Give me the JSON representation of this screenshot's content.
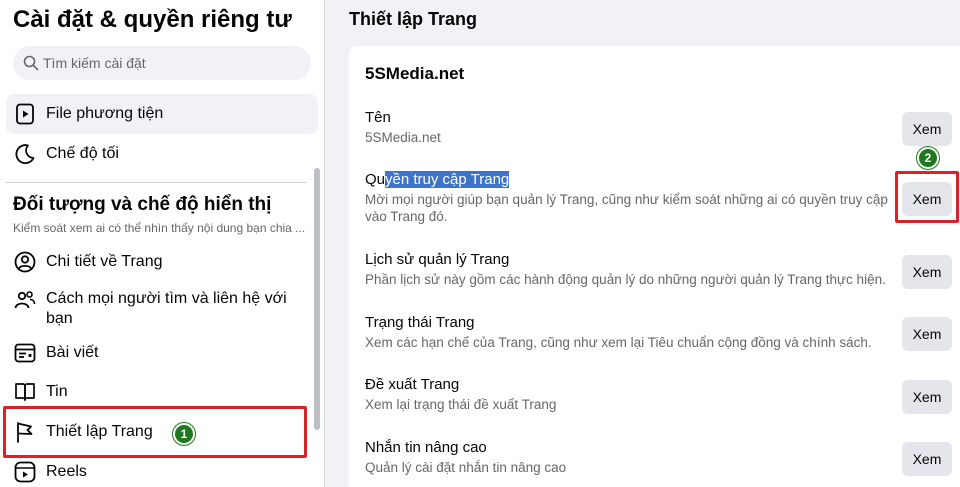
{
  "sidebar": {
    "title": "Cài đặt & quyền riêng tư",
    "search_placeholder": "Tìm kiếm cài đặt",
    "items_top": [
      {
        "label": "File phương tiện",
        "icon": "media-file-icon"
      },
      {
        "label": "Chế độ tối",
        "icon": "moon-icon"
      }
    ],
    "section_title": "Đối tượng và chế độ hiển thị",
    "section_subtitle": "Kiểm soát xem ai có thể nhìn thấy nội dung bạn chia ...",
    "items": [
      {
        "label": "Chi tiết về Trang",
        "icon": "person-icon"
      },
      {
        "label": "Cách mọi người tìm và liên hệ với bạn",
        "icon": "people-icon"
      },
      {
        "label": "Bài viết",
        "icon": "post-icon"
      },
      {
        "label": "Tin",
        "icon": "book-icon"
      },
      {
        "label": "Thiết lập Trang",
        "icon": "flag-icon"
      },
      {
        "label": "Reels",
        "icon": "reels-icon"
      }
    ]
  },
  "annotations": {
    "badge_1": "1",
    "badge_2": "2",
    "callout_color": "#d8232a",
    "badge_color": "#1f7a1f"
  },
  "main": {
    "title": "Thiết lập Trang",
    "card_heading": "5SMedia.net",
    "button_label": "Xem",
    "rows": [
      {
        "title": "Tên",
        "desc": "5SMedia.net"
      },
      {
        "title_pre": "Qu",
        "title_hl": "yền truy cập Trang",
        "desc": "Mời mọi người giúp bạn quản lý Trang, cũng như kiểm soát những ai có quyền truy cập vào Trang đó."
      },
      {
        "title": "Lịch sử quản lý Trang",
        "desc": "Phần lịch sử này gồm các hành động quản lý do những người quản lý Trang thực hiện."
      },
      {
        "title": "Trạng thái Trang",
        "desc": "Xem các hạn chế của Trang, cũng như xem lại Tiêu chuẩn cộng đồng và chính sách."
      },
      {
        "title": "Đề xuất Trang",
        "desc": "Xem lại trạng thái đề xuất Trang"
      },
      {
        "title": "Nhắn tin nâng cao",
        "desc": "Quản lý cài đặt nhắn tin nâng cao"
      }
    ]
  }
}
